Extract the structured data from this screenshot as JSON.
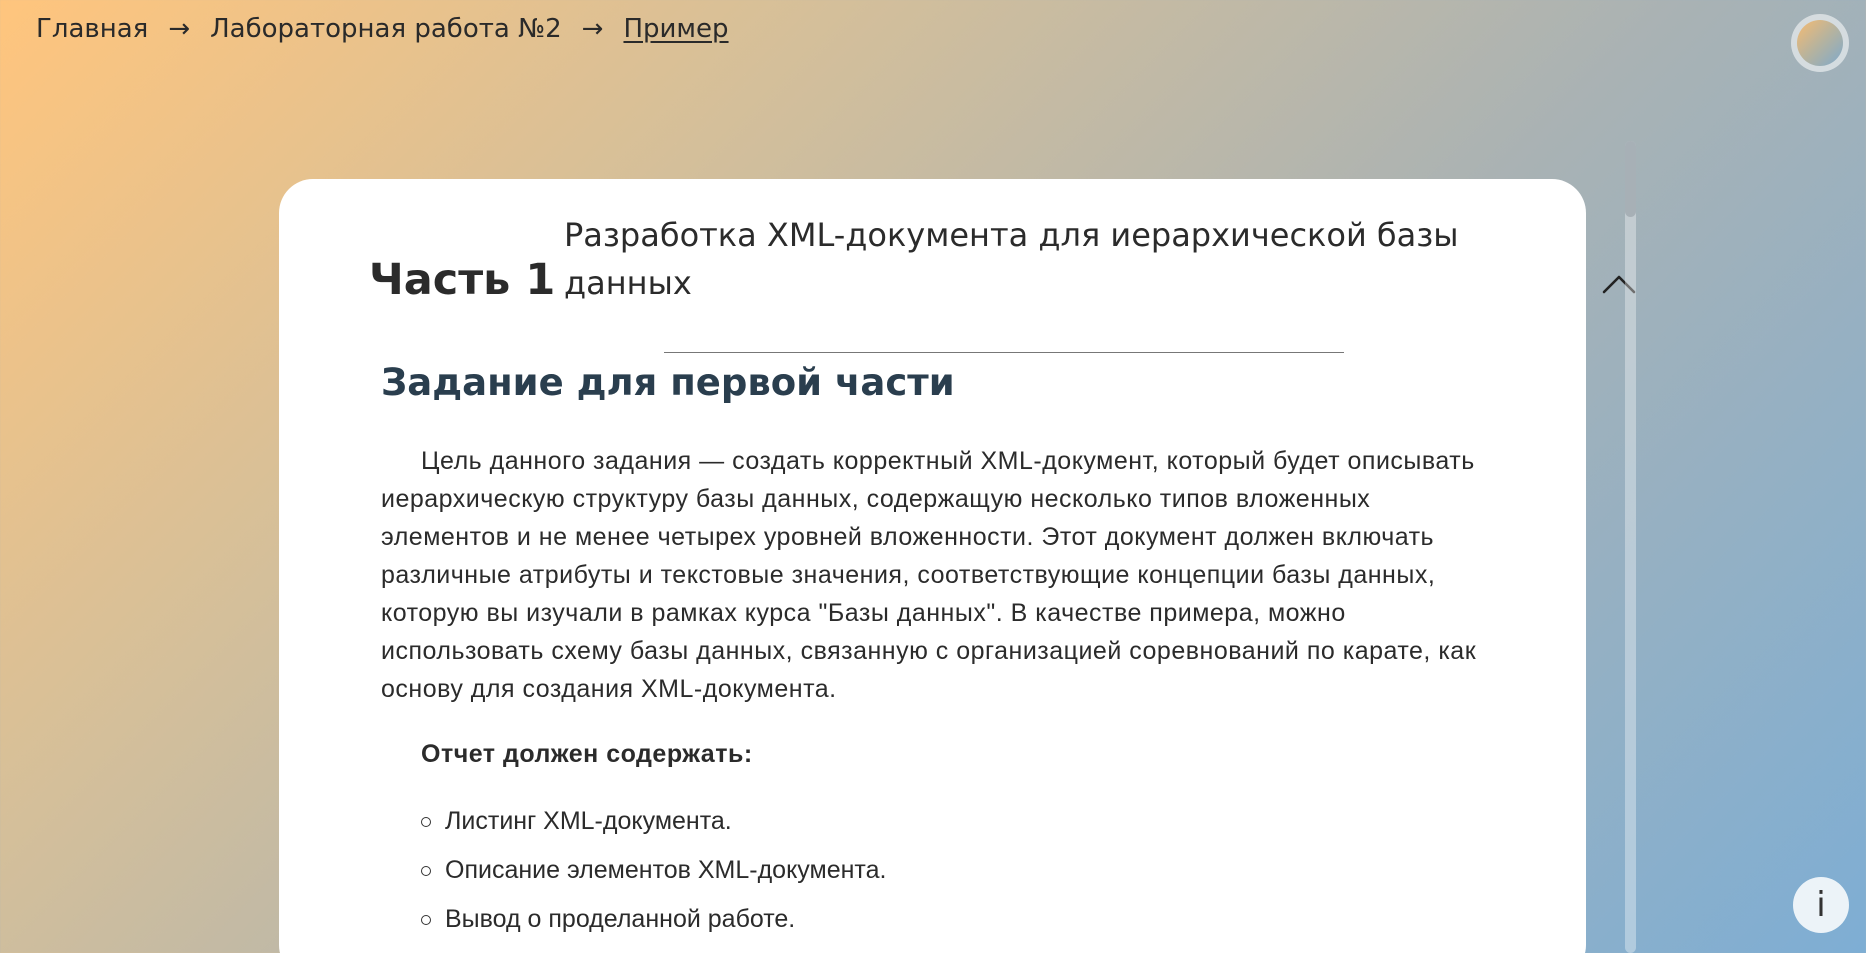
{
  "breadcrumb": {
    "items": [
      "Главная",
      "Лабораторная работа №2",
      "Пример"
    ],
    "separator": "→"
  },
  "part": {
    "number_label": "Часть 1",
    "title": "Разработка XML-документа для иерархической базы данных",
    "expanded": true
  },
  "task": {
    "heading": "Задание для первой части",
    "text": "Цель данного задания — создать корректный XML-документ, который будет описывать иерархическую структуру базы данных, содержащую несколько типов вложенных элементов и не менее четырех уровней вложенности. Этот документ должен включать различные атрибуты и текстовые значения, соответствующие концепции базы данных, которую вы изучали в рамках курса \"Базы данных\". В качестве примера, можно использовать схему базы данных, связанную с организацией соревнований по карате, как основу для создания XML-документа."
  },
  "report": {
    "heading": "Отчет должен содержать:",
    "items": [
      "Листинг XML-документа.",
      "Описание элементов XML-документа.",
      "Вывод о проделанной работе."
    ]
  },
  "info_button": {
    "label": "i"
  },
  "colors": {
    "gradient_start": "#ffc57d",
    "gradient_end": "#7eaed4",
    "card_bg": "#ffffff",
    "heading_color": "#2a3e4e"
  },
  "icons": {
    "theme_toggle": "theme-toggle-icon",
    "collapse": "chevron-up-icon",
    "info": "info-icon"
  }
}
